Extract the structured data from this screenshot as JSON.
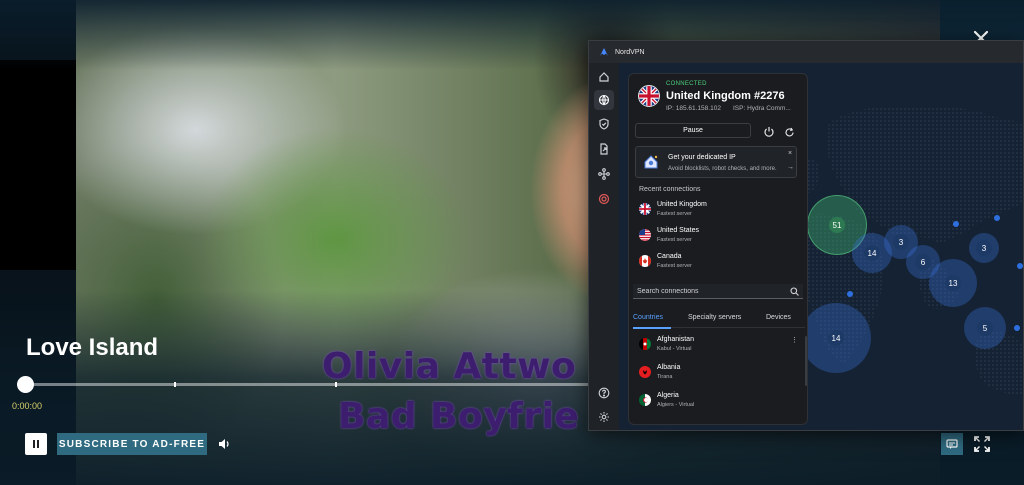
{
  "player": {
    "show_title": "Love Island",
    "current_time": "0:00:00",
    "subscribe_label": "SUBSCRIBE TO AD-FREE",
    "progress": 0.0,
    "caption_lines": [
      "Olivia Attwo",
      "Bad Boyfrie"
    ]
  },
  "vpn": {
    "app_name": "NordVPN",
    "status": "CONNECTED",
    "server": "United Kingdom #2276",
    "ip": "IP: 185.61.158.102",
    "isp": "ISP: Hydra Comm...",
    "pause_label": "Pause",
    "promo": {
      "title": "Get your dedicated IP",
      "subtitle": "Avoid blocklists, robot checks, and more.",
      "close": "×",
      "arrow": "→"
    },
    "recent_title": "Recent connections",
    "recent": [
      {
        "name": "United Kingdom",
        "sub": "Fastest server",
        "flag": "uk"
      },
      {
        "name": "United States",
        "sub": "Fastest server",
        "flag": "us"
      },
      {
        "name": "Canada",
        "sub": "Fastest server",
        "flag": "ca"
      }
    ],
    "search_placeholder": "Search connections",
    "tabs": [
      "Countries",
      "Specialty servers",
      "Devices"
    ],
    "active_tab": "Countries",
    "countries": [
      {
        "name": "Afghanistan",
        "sub": "Kabul - Virtual",
        "flag": "af"
      },
      {
        "name": "Albania",
        "sub": "Tirana",
        "flag": "al"
      },
      {
        "name": "Algeria",
        "sub": "Algiers - Virtual",
        "flag": "dz"
      }
    ],
    "map_counts": [
      "51",
      "14",
      "3",
      "6",
      "3",
      "14",
      "13",
      "5"
    ],
    "colors": {
      "connected": "#4cd07d",
      "accent": "#5aa0ff",
      "map_bg": "#152233",
      "connected_bubble": "#3aa36a",
      "bubble": "#3a6fd8"
    }
  }
}
